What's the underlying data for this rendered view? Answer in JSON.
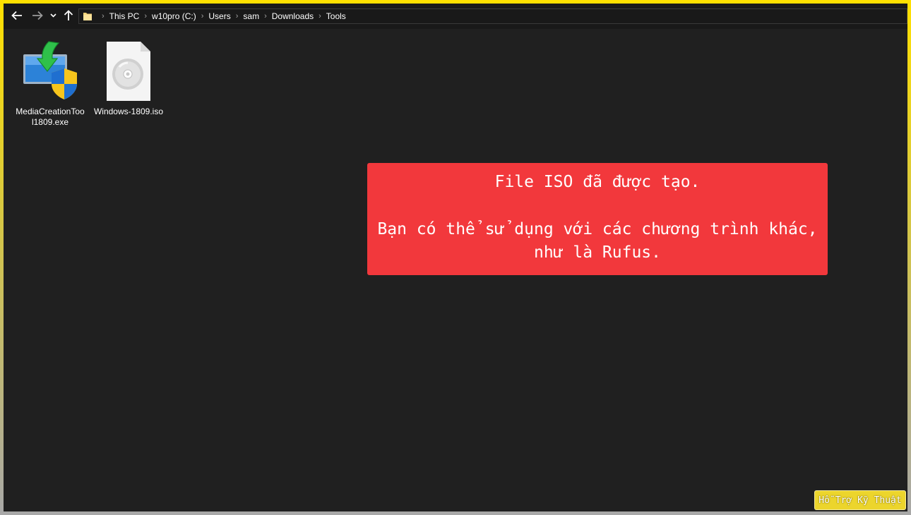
{
  "navigation": {
    "back_icon": "arrow-left-icon",
    "forward_icon": "arrow-right-icon",
    "recent_icon": "chevron-down-icon",
    "up_icon": "arrow-up-icon"
  },
  "address_bar": {
    "folder_icon": "folder-icon",
    "separator_icon": "chevron-right-icon",
    "crumbs": [
      "This PC",
      "w10pro (C:)",
      "Users",
      "sam",
      "Downloads",
      "Tools"
    ]
  },
  "files": [
    {
      "name": "MediaCreationTool1809.exe",
      "icon": "installer-shield-icon"
    },
    {
      "name": "Windows-1809.iso",
      "icon": "disc-image-icon"
    }
  ],
  "toast": {
    "line1": "File ISO đã được tạo.",
    "line2": "Bạn có thể sử dụng với các chương trình khác,",
    "line3": "như là Rufus."
  },
  "watermark": {
    "text": "Hỗ Trợ Kỹ Thuật"
  },
  "colors": {
    "window_bg": "#202020",
    "toast_bg": "#f2383c",
    "frame": "#ffe000",
    "watermark_bg": "#ecd52c"
  }
}
